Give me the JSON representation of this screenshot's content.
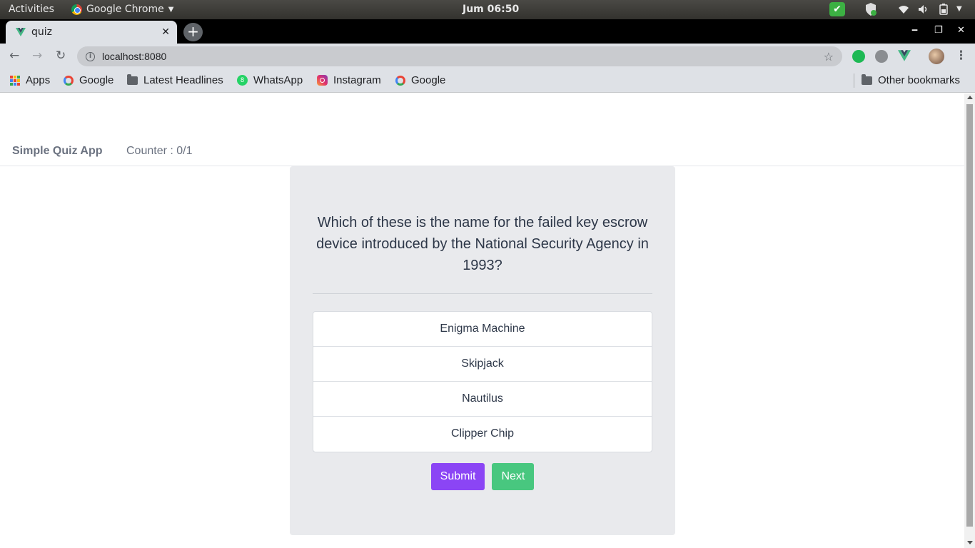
{
  "os_topbar": {
    "activities": "Activities",
    "app_name": "Google Chrome",
    "clock": "Jum 06:50"
  },
  "browser": {
    "tab_title": "quiz",
    "url": "localhost:8080",
    "bookmarks": [
      {
        "label": "Apps",
        "icon": "apps-icon"
      },
      {
        "label": "Google",
        "icon": "google-icon"
      },
      {
        "label": "Latest Headlines",
        "icon": "folder-icon"
      },
      {
        "label": "WhatsApp",
        "icon": "whatsapp-icon"
      },
      {
        "label": "Instagram",
        "icon": "instagram-icon"
      },
      {
        "label": "Google",
        "icon": "google-icon"
      }
    ],
    "other_bookmarks": "Other bookmarks"
  },
  "app": {
    "brand": "Simple Quiz App",
    "counter": "Counter : 0/1",
    "question": "Which of these is the name for the failed key escrow device introduced by the National Security Agency in 1993?",
    "answers": [
      "Enigma Machine",
      "Skipjack",
      "Nautilus",
      "Clipper Chip"
    ],
    "submit_label": "Submit",
    "next_label": "Next"
  },
  "colors": {
    "submit": "#8b45f5",
    "next": "#48c77f",
    "card": "#e9eaed"
  }
}
